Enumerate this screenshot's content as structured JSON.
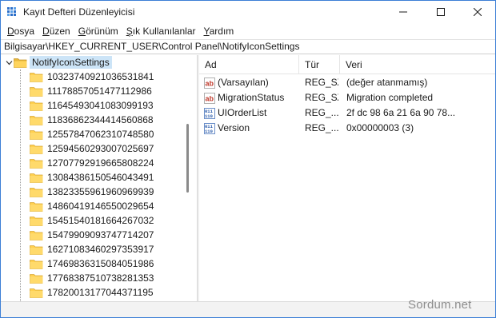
{
  "window": {
    "title": "Kayıt Defteri Düzenleyicisi",
    "accent": "#3d7fd6"
  },
  "menu": [
    {
      "accel": "D",
      "rest": "osya"
    },
    {
      "accel": "D",
      "rest": "üzen"
    },
    {
      "accel": "G",
      "rest": "örünüm"
    },
    {
      "accel": "Ş",
      "rest": "ık Kullanılanlar"
    },
    {
      "accel": "Y",
      "rest": "ardım"
    }
  ],
  "address": "Bilgisayar\\HKEY_CURRENT_USER\\Control Panel\\NotifyIconSettings",
  "tree": {
    "root": "NotifyIconSettings",
    "children": [
      "10323740921036531841",
      "11178857051477112986",
      "11645493041083099193",
      "11836862344414560868",
      "12557847062310748580",
      "12594560293007025697",
      "12707792919665808224",
      "13084386150546043491",
      "13823355961960969939",
      "14860419146550029654",
      "15451540181664267032",
      "15479909093747714207",
      "16271083460297353917",
      "17469836315084051986",
      "17768387510738281353",
      "17820013177044371195"
    ]
  },
  "list": {
    "headers": {
      "name": "Ad",
      "type": "Tür",
      "data": "Veri"
    },
    "rows": [
      {
        "icon": "string-value-icon",
        "name": "(Varsayılan)",
        "type": "REG_SZ",
        "data": "(değer atanmamış)"
      },
      {
        "icon": "string-value-icon",
        "name": "MigrationStatus",
        "type": "REG_SZ",
        "data": "Migration completed"
      },
      {
        "icon": "binary-value-icon",
        "name": "UIOrderList",
        "type": "REG_...",
        "data": "2f dc 98 6a 21 6a 90 78..."
      },
      {
        "icon": "binary-value-icon",
        "name": "Version",
        "type": "REG_...",
        "data": "0x00000003 (3)"
      }
    ]
  },
  "watermark": "Sordum.net"
}
